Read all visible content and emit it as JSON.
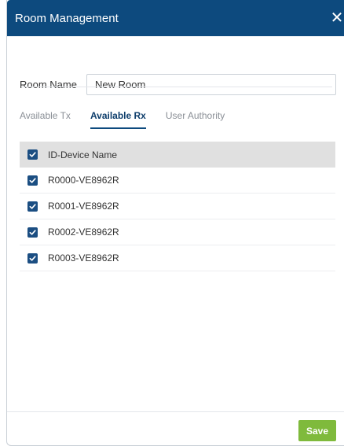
{
  "dialog": {
    "title": "Room Management",
    "close_icon": "close-icon",
    "close_glyph": "✕"
  },
  "room": {
    "label": "Room Name",
    "value": "New Room"
  },
  "tabs": [
    {
      "label": "Available Tx",
      "active": false
    },
    {
      "label": "Available Rx",
      "active": true
    },
    {
      "label": "User Authority",
      "active": false
    }
  ],
  "table": {
    "header": {
      "label": "ID-Device Name",
      "checked": true
    },
    "rows": [
      {
        "name": "R0000-VE8962R",
        "checked": true
      },
      {
        "name": "R0001-VE8962R",
        "checked": true
      },
      {
        "name": "R0002-VE8962R",
        "checked": true
      },
      {
        "name": "R0003-VE8962R",
        "checked": true
      }
    ]
  },
  "footer": {
    "save_label": "Save"
  },
  "colors": {
    "header_bg": "#0d4a7e",
    "checkbox": "#1b4e82",
    "save_bg": "#7fba3c",
    "active_tab": "#0d3d6b"
  }
}
